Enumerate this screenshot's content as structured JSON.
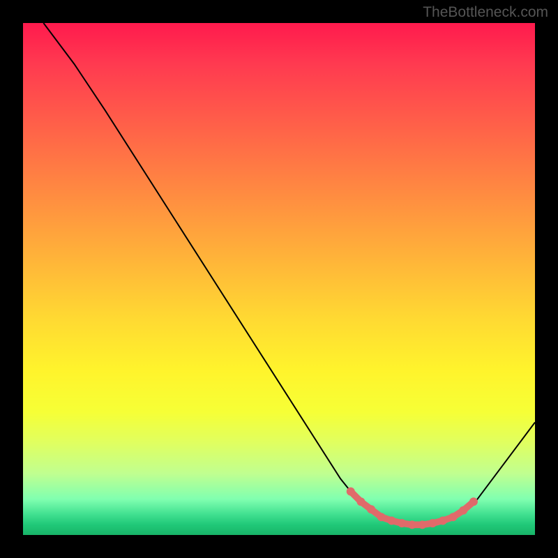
{
  "watermark": "TheBottleneck.com",
  "chart_data": {
    "type": "line",
    "title": "",
    "xlabel": "",
    "ylabel": "",
    "xlim": [
      0,
      100
    ],
    "ylim": [
      0,
      100
    ],
    "series": [
      {
        "name": "curve",
        "color": "#000000",
        "width": 2,
        "points": [
          {
            "x": 4,
            "y": 100
          },
          {
            "x": 10,
            "y": 92
          },
          {
            "x": 16,
            "y": 83
          },
          {
            "x": 62,
            "y": 11
          },
          {
            "x": 66,
            "y": 6
          },
          {
            "x": 70,
            "y": 3
          },
          {
            "x": 75,
            "y": 2
          },
          {
            "x": 80,
            "y": 2
          },
          {
            "x": 84,
            "y": 3
          },
          {
            "x": 88,
            "y": 6
          },
          {
            "x": 100,
            "y": 22
          }
        ]
      },
      {
        "name": "highlight-dots",
        "color": "#e06a6a",
        "radius": 6,
        "points": [
          {
            "x": 64,
            "y": 8.5
          },
          {
            "x": 66,
            "y": 6.5
          },
          {
            "x": 68,
            "y": 5
          },
          {
            "x": 70,
            "y": 3.5
          },
          {
            "x": 72,
            "y": 2.8
          },
          {
            "x": 74,
            "y": 2.3
          },
          {
            "x": 76,
            "y": 2
          },
          {
            "x": 78,
            "y": 2
          },
          {
            "x": 80,
            "y": 2.3
          },
          {
            "x": 82,
            "y": 2.8
          },
          {
            "x": 84,
            "y": 3.5
          },
          {
            "x": 86,
            "y": 4.8
          },
          {
            "x": 88,
            "y": 6.5
          }
        ]
      }
    ],
    "annotations": []
  }
}
